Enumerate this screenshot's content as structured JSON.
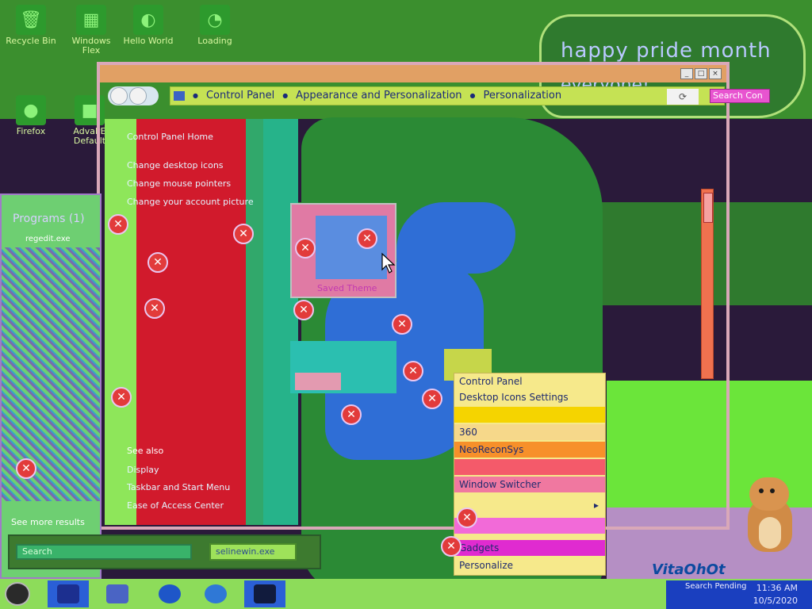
{
  "desktop": {
    "bubble_line1": "happy pride month",
    "bubble_line2": "everyone!",
    "icons": [
      {
        "label": "Recycle Bin",
        "icon": "recycle-bin-icon"
      },
      {
        "label": "Windows Flex",
        "icon": "windows-flex-icon"
      },
      {
        "label": "Hello World",
        "icon": "hello-world-icon"
      },
      {
        "label": "Loading",
        "icon": "loading-icon"
      },
      {
        "label": "Firefox",
        "icon": "firefox-icon"
      },
      {
        "label": "AdvaPE Default",
        "icon": "app-icon"
      }
    ]
  },
  "window": {
    "breadcrumb": [
      "Control Panel",
      "Appearance and Personalization",
      "Personalization"
    ],
    "search_placeholder": "Search Con",
    "left_pane": {
      "home_link": "Control Panel Home",
      "links": [
        "Change desktop icons",
        "Change mouse pointers",
        "Change your account picture"
      ],
      "see_also_header": "See also",
      "see_also": [
        "Display",
        "Taskbar and Start Menu",
        "Ease of Access Center"
      ]
    },
    "theme_label": "Saved Theme"
  },
  "start_menu": {
    "programs_header": "Programs (1)",
    "program_item": "regedit.exe",
    "see_more": "See more results",
    "search_value": "Search",
    "shutdown_label": "selinewin.exe"
  },
  "context_menu": {
    "items": [
      {
        "label": "Control Panel"
      },
      {
        "label": "Desktop Icons Settings"
      },
      {
        "label": ""
      },
      {
        "label": "360"
      },
      {
        "label": "NeoReconSys"
      },
      {
        "label": ""
      },
      {
        "label": "Window Switcher"
      },
      {
        "label": "",
        "submenu": true
      },
      {
        "label": ""
      },
      {
        "label": "Gadgets"
      },
      {
        "label": "Personalize"
      }
    ]
  },
  "watermark": "VitaOhOt",
  "taskbar": {
    "tray_tag": "Search Pending",
    "time": "11:36 AM",
    "date": "10/5/2020"
  },
  "colors": {
    "context_bg": "#f6e98b",
    "breadcrumb_bg": "#c5e254",
    "taskbar_bg": "#8ddc5a",
    "error_badge": "#e23b3b"
  }
}
